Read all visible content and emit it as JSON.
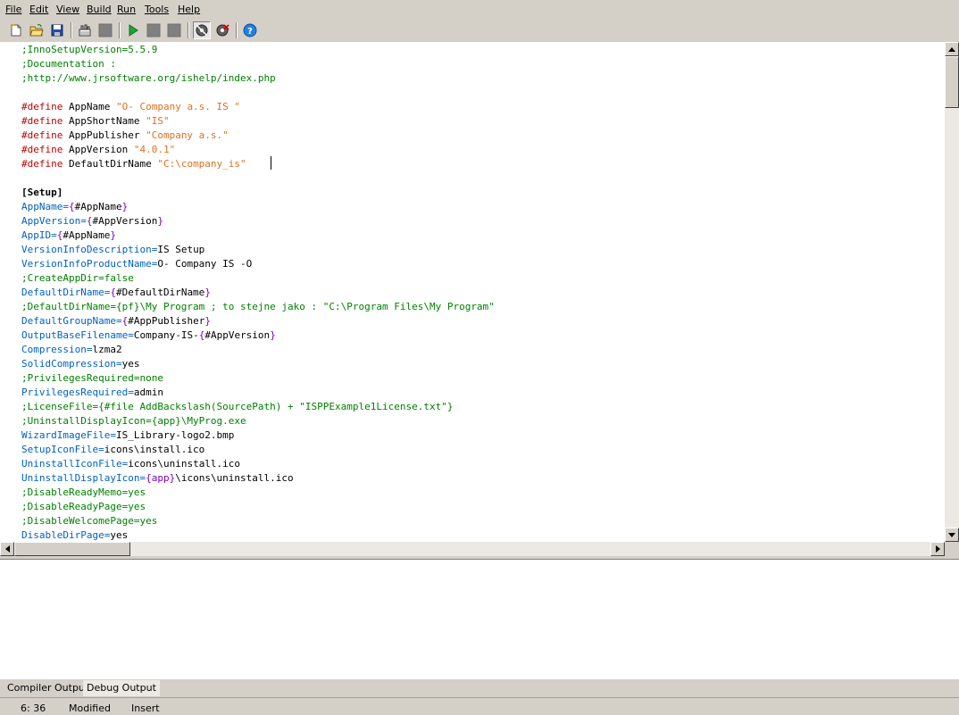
{
  "menu": {
    "items": [
      {
        "label": "File"
      },
      {
        "label": "Edit"
      },
      {
        "label": "View"
      },
      {
        "label": "Build"
      },
      {
        "label": "Run"
      },
      {
        "label": "Tools"
      },
      {
        "label": "Help"
      }
    ]
  },
  "toolbar": {
    "buttons": [
      {
        "icon": "new-file-icon"
      },
      {
        "icon": "open-folder-icon"
      },
      {
        "icon": "save-disk-icon"
      },
      {
        "icon": "compile-icon"
      },
      {
        "icon": "stop-compile-icon"
      },
      {
        "icon": "run-icon"
      },
      {
        "icon": "pause-icon"
      },
      {
        "icon": "terminate-icon"
      },
      {
        "icon": "target-setup-icon"
      },
      {
        "icon": "target-uninstall-icon"
      },
      {
        "icon": "help-icon"
      }
    ]
  },
  "editor": {
    "lines": [
      [
        {
          "t": ";InnoSetupVersion=5.5.9",
          "c": "comment"
        }
      ],
      [
        {
          "t": ";Documentation :",
          "c": "comment"
        }
      ],
      [
        {
          "t": ";http://www.jrsoftware.org/ishelp/index.php",
          "c": "comment"
        }
      ],
      [],
      [
        {
          "t": "#define",
          "c": "pre"
        },
        {
          "t": " AppName ",
          "c": "txt"
        },
        {
          "t": "\"O- Company a.s. IS \"",
          "c": "str"
        }
      ],
      [
        {
          "t": "#define",
          "c": "pre"
        },
        {
          "t": " AppShortName ",
          "c": "txt"
        },
        {
          "t": "\"IS\"",
          "c": "str"
        }
      ],
      [
        {
          "t": "#define",
          "c": "pre"
        },
        {
          "t": " AppPublisher ",
          "c": "txt"
        },
        {
          "t": "\"Company a.s.\"",
          "c": "str"
        }
      ],
      [
        {
          "t": "#define",
          "c": "pre"
        },
        {
          "t": " AppVersion ",
          "c": "txt"
        },
        {
          "t": "\"4.0.1\"",
          "c": "str"
        }
      ],
      [
        {
          "t": "#define",
          "c": "pre"
        },
        {
          "t": " DefaultDirName ",
          "c": "txt"
        },
        {
          "t": "\"C:\\company_is\"",
          "c": "str"
        }
      ],
      [],
      [
        {
          "t": "[Setup]",
          "c": "sec"
        }
      ],
      [
        {
          "t": "AppName",
          "c": "key"
        },
        {
          "t": "=",
          "c": "key"
        },
        {
          "t": "{",
          "c": "const"
        },
        {
          "t": "#AppName",
          "c": "txt"
        },
        {
          "t": "}",
          "c": "const"
        }
      ],
      [
        {
          "t": "AppVersion",
          "c": "key"
        },
        {
          "t": "=",
          "c": "key"
        },
        {
          "t": "{",
          "c": "const"
        },
        {
          "t": "#AppVersion",
          "c": "txt"
        },
        {
          "t": "}",
          "c": "const"
        }
      ],
      [
        {
          "t": "AppID",
          "c": "key"
        },
        {
          "t": "=",
          "c": "key"
        },
        {
          "t": "{",
          "c": "const"
        },
        {
          "t": "#AppName",
          "c": "txt"
        },
        {
          "t": "}",
          "c": "const"
        }
      ],
      [
        {
          "t": "VersionInfoDescription",
          "c": "key"
        },
        {
          "t": "=",
          "c": "key"
        },
        {
          "t": "IS Setup",
          "c": "txt"
        }
      ],
      [
        {
          "t": "VersionInfoProductName",
          "c": "key"
        },
        {
          "t": "=",
          "c": "key"
        },
        {
          "t": "O- Company IS -O",
          "c": "txt"
        }
      ],
      [
        {
          "t": ";CreateAppDir=false",
          "c": "comment"
        }
      ],
      [
        {
          "t": "DefaultDirName",
          "c": "key"
        },
        {
          "t": "=",
          "c": "key"
        },
        {
          "t": "{",
          "c": "const"
        },
        {
          "t": "#DefaultDirName",
          "c": "txt"
        },
        {
          "t": "}",
          "c": "const"
        }
      ],
      [
        {
          "t": ";DefaultDirName={pf}\\My Program ; to stejne jako : \"C:\\Program Files\\My Program\"",
          "c": "comment"
        }
      ],
      [
        {
          "t": "DefaultGroupName",
          "c": "key"
        },
        {
          "t": "=",
          "c": "key"
        },
        {
          "t": "{",
          "c": "const"
        },
        {
          "t": "#AppPublisher",
          "c": "txt"
        },
        {
          "t": "}",
          "c": "const"
        }
      ],
      [
        {
          "t": "OutputBaseFilename",
          "c": "key"
        },
        {
          "t": "=",
          "c": "key"
        },
        {
          "t": "Company-IS-",
          "c": "txt"
        },
        {
          "t": "{",
          "c": "const"
        },
        {
          "t": "#AppVersion",
          "c": "txt"
        },
        {
          "t": "}",
          "c": "const"
        }
      ],
      [
        {
          "t": "Compression",
          "c": "key"
        },
        {
          "t": "=",
          "c": "key"
        },
        {
          "t": "lzma2",
          "c": "txt"
        }
      ],
      [
        {
          "t": "SolidCompression",
          "c": "key"
        },
        {
          "t": "=",
          "c": "key"
        },
        {
          "t": "yes",
          "c": "txt"
        }
      ],
      [
        {
          "t": ";PrivilegesRequired=none",
          "c": "comment"
        }
      ],
      [
        {
          "t": "PrivilegesRequired",
          "c": "key"
        },
        {
          "t": "=",
          "c": "key"
        },
        {
          "t": "admin",
          "c": "txt"
        }
      ],
      [
        {
          "t": ";LicenseFile={#file AddBackslash(SourcePath) + \"ISPPExample1License.txt\"}",
          "c": "comment"
        }
      ],
      [
        {
          "t": ";UninstallDisplayIcon={app}\\MyProg.exe",
          "c": "comment"
        }
      ],
      [
        {
          "t": "WizardImageFile",
          "c": "key"
        },
        {
          "t": "=",
          "c": "key"
        },
        {
          "t": "IS_Library-logo2.bmp",
          "c": "txt"
        }
      ],
      [
        {
          "t": "SetupIconFile",
          "c": "key"
        },
        {
          "t": "=",
          "c": "key"
        },
        {
          "t": "icons\\install.ico",
          "c": "txt"
        }
      ],
      [
        {
          "t": "UninstallIconFile",
          "c": "key"
        },
        {
          "t": "=",
          "c": "key"
        },
        {
          "t": "icons\\uninstall.ico",
          "c": "txt"
        }
      ],
      [
        {
          "t": "UninstallDisplayIcon",
          "c": "key"
        },
        {
          "t": "=",
          "c": "key"
        },
        {
          "t": "{app}",
          "c": "const"
        },
        {
          "t": "\\icons\\uninstall.ico",
          "c": "txt"
        }
      ],
      [
        {
          "t": ";DisableReadyMemo=yes",
          "c": "comment"
        }
      ],
      [
        {
          "t": ";DisableReadyPage=yes",
          "c": "comment"
        }
      ],
      [
        {
          "t": ";DisableWelcomePage=yes",
          "c": "comment"
        }
      ],
      [
        {
          "t": "DisableDirPage",
          "c": "key"
        },
        {
          "t": "=",
          "c": "key"
        },
        {
          "t": "yes",
          "c": "txt"
        }
      ]
    ]
  },
  "tabs": [
    {
      "label": "Compiler Output",
      "active": false
    },
    {
      "label": "Debug Output",
      "active": true
    }
  ],
  "status": {
    "position": "6: 36",
    "modified": "Modified",
    "mode": "Insert"
  }
}
